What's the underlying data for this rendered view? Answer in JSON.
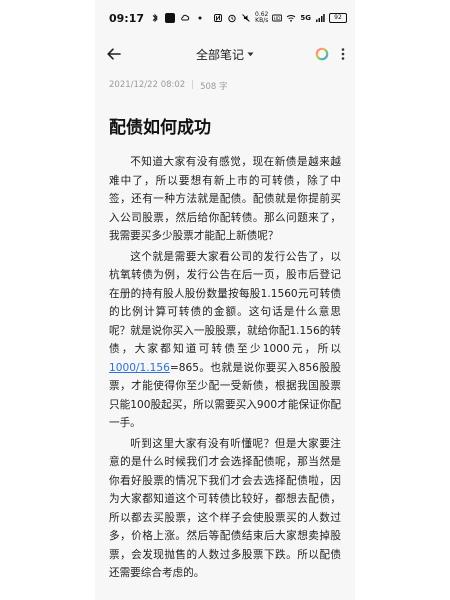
{
  "status_bar": {
    "time": "09:17",
    "network_speed": "0.62",
    "network_unit": "KB/s",
    "signal": "5G",
    "battery": "92"
  },
  "header": {
    "title": "全部笔记",
    "icons": [
      "back-arrow-icon",
      "chevron-down-icon",
      "color-ring-icon",
      "more-vertical-icon"
    ]
  },
  "note": {
    "date": "2021/12/22 08:02",
    "separator": "|",
    "word_count": "508 字",
    "title": "配债如何成功",
    "paragraph1": "不知道大家有没有感觉，现在新债是越来越难中了，所以要想有新上市的可转债，除了中签，还有一种方法就是配债。配债就是你提前买入公司股票，然后给你配转债。那么问题来了，我需要买多少股票才能配上新债呢？",
    "paragraph2_part1": "这个就是需要大家看公司的发行公告了，以杭氧转债为例，发行公告在后一页，股市后登记在册的持有股人股份数量按每股1.1560元可转债的比例计算可转债的金额。这句话是什么意思呢？就是说你买入一股股票，就给你配1.156的转债，大家都知道可转债至少1000元，所以",
    "paragraph2_link": "1000/1.156",
    "paragraph2_part2": "=865。也就是说你要买入856股股票，才能使得你至少配一受新债，根据我国股票只能100股起买，所以需要买入900才能保证你配一手。",
    "paragraph3": "听到这里大家有没有听懂呢？但是大家要注意的是什么时候我们才会选择配债呢，那当然是你看好股票的情况下我们才会去选择配债啦，因为大家都知道这个可转债比较好，都想去配债，所以都去买股票，这个样子会使股票买的人数过多，价格上涨。然后等配债结束后大家想卖掉股票，会发现抛售的人数过多股票下跌。所以配债还需要综合考虑的。"
  },
  "colors": {
    "link": "#2f6fd6",
    "text": "#1f1f1f",
    "meta": "#9a9a9a",
    "background": "#f7f7f7"
  }
}
